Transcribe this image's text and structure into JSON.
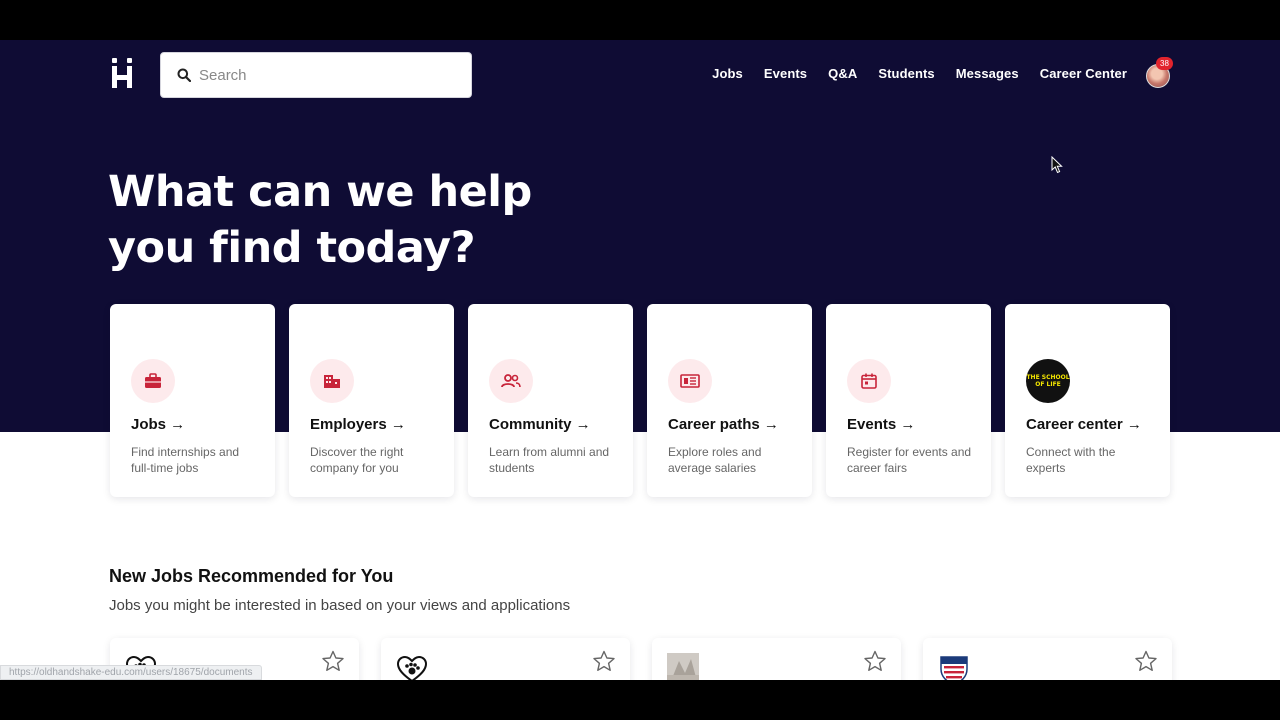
{
  "header": {
    "logo_alt": "handshake",
    "search_placeholder": "Search",
    "nav": [
      "Jobs",
      "Events",
      "Q&A",
      "Students",
      "Messages",
      "Career Center"
    ],
    "notifications_count": "38"
  },
  "hero": {
    "headline_line1": "What can we help",
    "headline_line2": "you find today?"
  },
  "cards": [
    {
      "title": "Jobs →",
      "desc": "Find internships and full-time jobs",
      "icon": "briefcase-icon"
    },
    {
      "title": "Employers →",
      "desc": "Discover the right company for you",
      "icon": "building-icon"
    },
    {
      "title": "Community →",
      "desc": "Learn from alumni and students",
      "icon": "people-icon"
    },
    {
      "title": "Career paths →",
      "desc": "Explore roles and average salaries",
      "icon": "id-card-icon"
    },
    {
      "title": "Events →",
      "desc": "Register for events and career fairs",
      "icon": "calendar-icon"
    },
    {
      "title": "Career center →",
      "desc": "Connect with the experts",
      "icon": "school-of-life-logo",
      "logo_text": "THE SCHOOL OF LIFE"
    }
  ],
  "section": {
    "title": "New Jobs Recommended for You",
    "subtitle": "Jobs you might be interested in based on your views and applications"
  },
  "status_url": "https://oldhandshake-edu.com/users/18675/documents",
  "colors": {
    "hero_bg": "#0f0c34",
    "accent_red": "#c8243a",
    "icon_bg": "#fdeaec",
    "badge": "#e2242d"
  }
}
